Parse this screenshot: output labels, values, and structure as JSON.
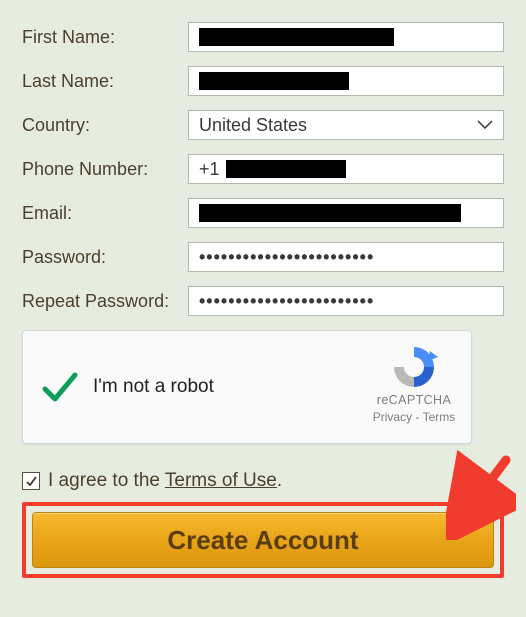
{
  "form": {
    "first_name": {
      "label": "First Name:"
    },
    "last_name": {
      "label": "Last Name:"
    },
    "country": {
      "label": "Country:",
      "value": "United States"
    },
    "phone": {
      "label": "Phone Number:",
      "prefix": "+1"
    },
    "email": {
      "label": "Email:"
    },
    "password": {
      "label": "Password:",
      "value": "••••••••••••••••••••••••"
    },
    "repeat_password": {
      "label": "Repeat Password:",
      "value": "••••••••••••••••••••••••"
    }
  },
  "recaptcha": {
    "label": "I'm not a robot",
    "brand": "reCAPTCHA",
    "privacy": "Privacy",
    "dash": " - ",
    "terms": "Terms"
  },
  "agree": {
    "prefix": "I agree to the ",
    "link": "Terms of Use",
    "suffix": "."
  },
  "button": {
    "label": "Create Account"
  }
}
